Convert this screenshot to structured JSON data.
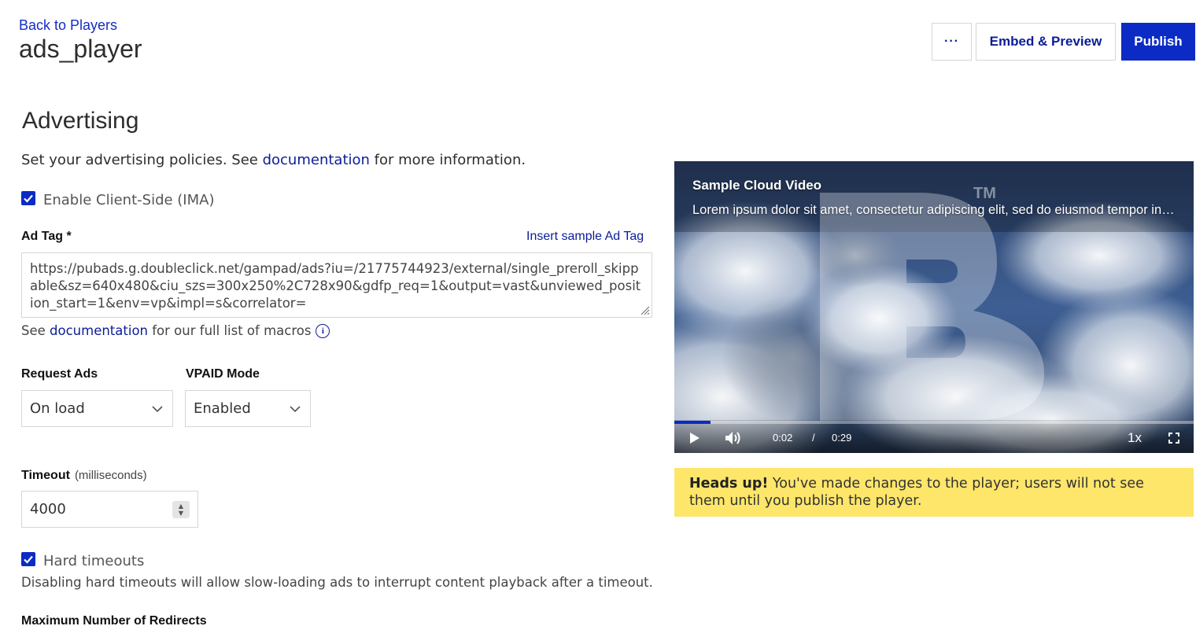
{
  "header": {
    "back_link": "Back to Players",
    "player_name": "ads_player",
    "more_label": "···",
    "embed_label": "Embed & Preview",
    "publish_label": "Publish"
  },
  "advertising": {
    "title": "Advertising",
    "intro_prefix": "Set your advertising policies. See ",
    "intro_link": "documentation",
    "intro_suffix": " for more information.",
    "enable_ima_label": "Enable Client-Side (IMA)",
    "enable_ima_checked": true,
    "ad_tag_label": "Ad Tag *",
    "insert_sample_label": "Insert sample Ad Tag",
    "ad_tag_value": "https://pubads.g.doubleclick.net/gampad/ads?iu=/21775744923/external/single_preroll_skippable&sz=640x480&ciu_szs=300x250%2C728x90&gdfp_req=1&output=vast&unviewed_position_start=1&env=vp&impl=s&correlator=",
    "macro_prefix": "See ",
    "macro_link": "documentation",
    "macro_suffix": " for our full list of macros",
    "request_ads_label": "Request Ads",
    "request_ads_value": "On load",
    "vpaid_label": "VPAID Mode",
    "vpaid_value": "Enabled",
    "timeout_label": "Timeout",
    "timeout_unit": "(milliseconds)",
    "timeout_value": "4000",
    "hard_timeouts_label": "Hard timeouts",
    "hard_timeouts_checked": true,
    "hard_timeouts_hint": "Disabling hard timeouts will allow slow-loading ads to interrupt content playback after a timeout.",
    "max_redirects_label": "Maximum Number of Redirects"
  },
  "video": {
    "title": "Sample Cloud Video",
    "description": "Lorem ipsum dolor sit amet, consectetur adipiscing elit, sed do eiusmod tempor incididunt ut labore",
    "current_time": "0:02",
    "separator": "/",
    "duration": "0:29",
    "progress": 0.07,
    "speed": "1x",
    "watermark": "B",
    "trademark": "TM"
  },
  "notice": {
    "bold": "Heads up!",
    "text": " You've made changes to the player; users will not see them until you publish the player."
  },
  "colors": {
    "accent": "#0b2bc4",
    "link": "#0b1d96",
    "notice_bg": "#fde66a"
  }
}
